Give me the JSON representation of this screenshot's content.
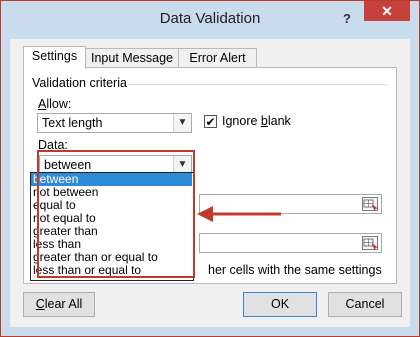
{
  "window": {
    "title": "Data Validation",
    "help_label": "?",
    "close_label": "✕"
  },
  "tabs": [
    {
      "label": "Settings",
      "active": true
    },
    {
      "label": "Input Message",
      "active": false
    },
    {
      "label": "Error Alert",
      "active": false
    }
  ],
  "settings": {
    "group_title": "Validation criteria",
    "allow": {
      "label_underlined": "A",
      "label_rest": "llow:",
      "value": "Text length"
    },
    "ignore_blank": {
      "checked": true,
      "label_before": "Ignore ",
      "label_underlined": "b",
      "label_after": "lank"
    },
    "data": {
      "label_underlined": "D",
      "label_rest": "ata:",
      "value": "between",
      "options": [
        "between",
        "not between",
        "equal to",
        "not equal to",
        "greater than",
        "less than",
        "greater than or equal to",
        "less than or equal to"
      ],
      "selected_index": 0
    },
    "apply_all_visible_text": "her cells with the same settings"
  },
  "buttons": {
    "clear_all_underlined": "C",
    "clear_all_rest": "lear All",
    "ok": "OK",
    "cancel": "Cancel"
  },
  "colors": {
    "accent_red": "#c0392b",
    "selection_blue": "#2f8ad7",
    "window_frame": "#c9dcee"
  }
}
